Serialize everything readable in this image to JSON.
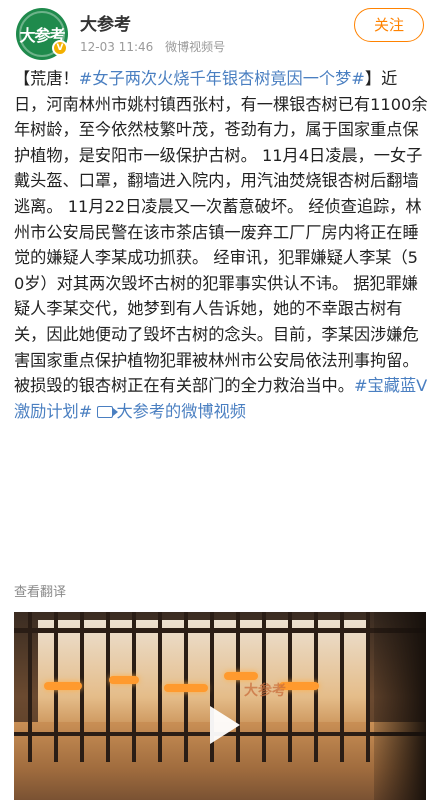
{
  "header": {
    "avatar_text": "大参考",
    "author": "大参考",
    "date": "12-03 11:46",
    "source": "微博视频号",
    "follow_label": "关注"
  },
  "post": {
    "seg1": "【荒唐！",
    "topic1": "#女子两次火烧千年银杏树竟因一个梦#",
    "seg2": "】近日，河南林州市姚村镇西张村，有一棵银杏树已有1100余年树龄，至今依然枝繁叶茂，苍劲有力，属于国家重点保护植物，是安阳市一级保护古树。 11月4日凌晨，一女子戴头盔、口罩，翻墙进入院内，用汽油焚烧银杏树后翻墙逃离。 11月22日凌晨又一次蓄意破坏。 经侦查追踪，林州市公安局民警在该市茶店镇一废弃工厂厂房内将正在睡觉的嫌疑人李某成功抓获。 经审讯，犯罪嫌疑人李某（50岁）对其两次毁坏古树的犯罪事实供认不讳。 据犯罪嫌疑人李某交代，她梦到有人告诉她，她的不幸跟古树有关，因此她便动了毁坏古树的念头。目前，李某因涉嫌危害国家重点保护植物犯罪被林州市公安局依法刑事拘留。被损毁的银杏树正在有关部门的全力救治当中。",
    "topic2": "#宝藏蓝V激励计划#",
    "video_link": "大参考的微博视频"
  },
  "translate_label": "查看翻译",
  "video": {
    "watermark": "大参考"
  },
  "colors": {
    "accent": "#ff8200",
    "link": "#4a7fc1"
  }
}
